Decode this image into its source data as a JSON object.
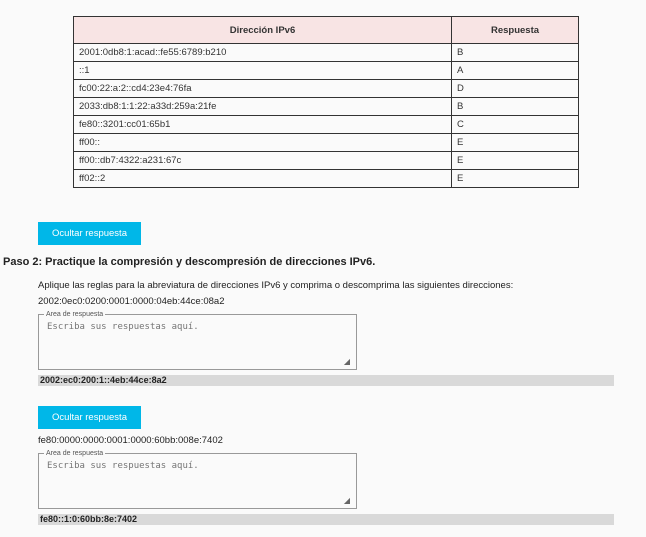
{
  "table": {
    "headers": [
      "Dirección IPv6",
      "Respuesta"
    ],
    "rows": [
      [
        "2001:0db8:1:acad::fe55:6789:b210",
        "B"
      ],
      [
        "::1",
        "A"
      ],
      [
        "fc00:22:a:2::cd4:23e4:76fa",
        "D"
      ],
      [
        "2033:db8:1:1:22:a33d:259a:21fe",
        "B"
      ],
      [
        "fe80::3201:cc01:65b1",
        "C"
      ],
      [
        "ff00::",
        "E"
      ],
      [
        "ff00::db7:4322:a231:67c",
        "E"
      ],
      [
        "ff02::2",
        "E"
      ]
    ]
  },
  "buttons": {
    "hide_answer": "Ocultar respuesta"
  },
  "step2": {
    "title": "Paso 2: Practique la compresión y descompresión de direcciones IPv6.",
    "instructions": "Aplique las reglas para la abreviatura de direcciones IPv6 y comprima o descomprima las siguientes direcciones:",
    "answer_legend": "Area de respuesta",
    "answer_placeholder": "Escriba sus respuestas aquí.",
    "items": [
      {
        "address": "2002:0ec0:0200:0001:0000:04eb:44ce:08a2",
        "answer": "2002:ec0:200:1::4eb:44ce:8a2"
      },
      {
        "address": "fe80:0000:0000:0001:0000:60bb:008e:7402",
        "answer": "fe80::1:0:60bb:8e:7402"
      }
    ]
  }
}
